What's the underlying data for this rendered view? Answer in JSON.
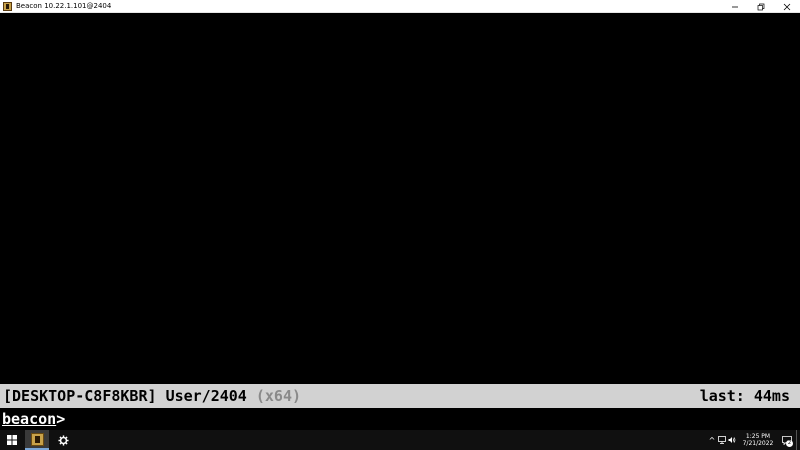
{
  "window": {
    "title": "Beacon 10.22.1.101@2404",
    "app_icon": "beacon-icon",
    "controls": [
      "minimize-icon",
      "restore-icon",
      "close-icon"
    ]
  },
  "status": {
    "host": "[DESKTOP-C8F8KBR]",
    "user": "User/2404",
    "arch": "(x64)",
    "last": "last: 44ms"
  },
  "input": {
    "prompt": "beacon",
    "caret": ">",
    "value": ""
  },
  "taskbar": {
    "start_icon": "windows-start-icon",
    "pinned": [
      {
        "name": "beacon-app-icon",
        "active": true
      },
      {
        "name": "settings-icon",
        "active": false
      }
    ],
    "tray": {
      "chevron": "^",
      "time": "1:25 PM",
      "date": "7/21/2022",
      "notification_count": "2"
    }
  },
  "colors": {
    "status_bar_bg": "#d2d2d2",
    "arch_text": "#8a8a8a",
    "console_bg": "#000000",
    "taskbar_bg": "#101010"
  }
}
